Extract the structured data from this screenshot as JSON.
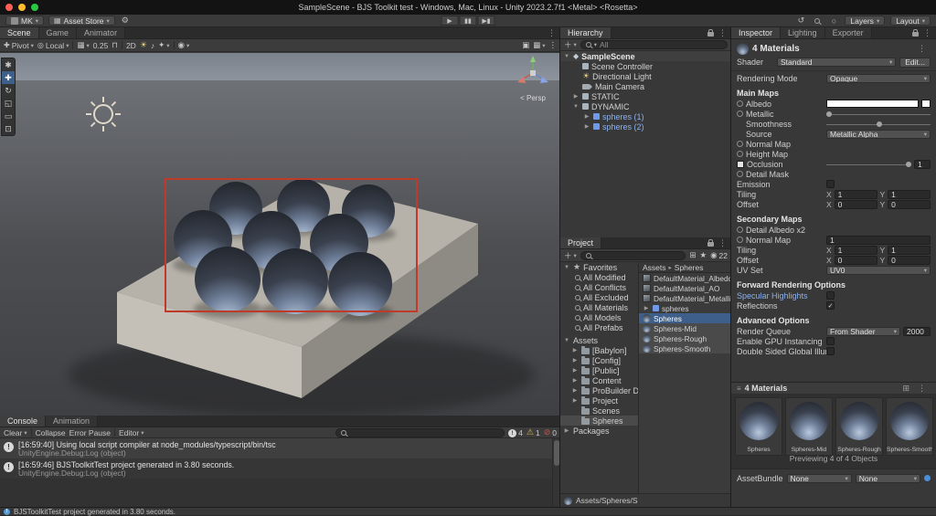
{
  "menubar": {
    "title": "SampleScene - BJS Toolkit test - Windows, Mac, Linux - Unity 2023.2.7f1 <Metal> <Rosetta>"
  },
  "topbar": {
    "account": "MK",
    "asset_store": "Asset Store",
    "layers": "Layers",
    "layout": "Layout"
  },
  "scene": {
    "tabs": [
      "Scene",
      "Game",
      "Animator"
    ],
    "pivot": "Pivot",
    "local": "Local",
    "snap": "0.25",
    "two_d": "2D",
    "persp": "< Persp"
  },
  "console": {
    "tabs": [
      "Console",
      "Animation"
    ],
    "clear": "Clear",
    "collapse": "Collapse",
    "error_pause": "Error Pause",
    "editor": "Editor",
    "info_count": "4",
    "warn_count": "1",
    "error_count": "0",
    "entries": [
      {
        "line1": "[16:59:40] Using local script compiler at node_modules/typescript/bin/tsc",
        "line2": "UnityEngine.Debug:Log (object)"
      },
      {
        "line1": "[16:59:46] BJSToolkitTest project generated in 3.80 seconds.",
        "line2": "UnityEngine.Debug:Log (object)"
      }
    ]
  },
  "hierarchy": {
    "tab": "Hierarchy",
    "search": "All",
    "items": [
      {
        "label": "SampleScene"
      },
      {
        "label": "Scene Controller"
      },
      {
        "label": "Directional Light"
      },
      {
        "label": "Main Camera"
      },
      {
        "label": "STATIC"
      },
      {
        "label": "DYNAMIC"
      },
      {
        "label": "spheres (1)"
      },
      {
        "label": "spheres (2)"
      }
    ]
  },
  "project": {
    "tab": "Project",
    "hidden_count": "22",
    "favorites_label": "Favorites",
    "favorites": [
      "All Modified",
      "All Conflicts",
      "All Excluded",
      "All Materials",
      "All Models",
      "All Prefabs"
    ],
    "assets_label": "Assets",
    "folders": [
      "[Babylon]",
      "[Config]",
      "[Public]",
      "Content",
      "ProBuilder Data",
      "Project",
      "Scenes",
      "Spheres"
    ],
    "packages_label": "Packages",
    "breadcrumb_root": "Assets",
    "breadcrumb_current": "Spheres",
    "files": [
      "DefaultMaterial_Albedo",
      "DefaultMaterial_AO",
      "DefaultMaterial_Metallic",
      "spheres",
      "Spheres",
      "Spheres-Mid",
      "Spheres-Rough",
      "Spheres-Smooth"
    ],
    "footer_path": "Assets/Spheres/S"
  },
  "inspector": {
    "tabs": [
      "Inspector",
      "Lighting",
      "Exporter"
    ],
    "title": "4 Materials",
    "shader_label": "Shader",
    "shader_value": "Standard",
    "edit_button": "Edit...",
    "rendering_mode_label": "Rendering Mode",
    "rendering_mode_value": "Opaque",
    "main_maps": "Main Maps",
    "albedo": "Albedo",
    "metallic": "Metallic",
    "smoothness": "Smoothness",
    "source_label": "Source",
    "source_value": "Metallic Alpha",
    "normal_map": "Normal Map",
    "height_map": "Height Map",
    "occlusion": "Occlusion",
    "occlusion_value": "1",
    "detail_mask": "Detail Mask",
    "emission": "Emission",
    "tiling": "Tiling",
    "offset": "Offset",
    "x": "X",
    "y": "Y",
    "tiling_x": "1",
    "tiling_y": "1",
    "offset_x": "0",
    "offset_y": "0",
    "secondary_maps": "Secondary Maps",
    "detail_albedo": "Detail Albedo x2",
    "normal_map2": "Normal Map",
    "normal_map2_value": "1",
    "tiling2_x": "1",
    "tiling2_y": "1",
    "offset2_x": "0",
    "offset2_y": "0",
    "uv_set_label": "UV Set",
    "uv_set_value": "UV0",
    "forward_header": "Forward Rendering Options",
    "specular": "Specular Highlights",
    "reflections": "Reflections",
    "advanced_header": "Advanced Options",
    "render_queue_label": "Render Queue",
    "render_queue_value": "From Shader",
    "render_queue_number": "2000",
    "gpu_instancing": "Enable GPU Instancing",
    "double_sided": "Double Sided Global Illum",
    "preview_header": "4 Materials",
    "previews": [
      "Spheres",
      "Spheres-Mid",
      "Spheres-Rough",
      "Spheres-Smooth"
    ],
    "preview_status": "Previewing 4 of 4 Objects",
    "assetbundle_label": "AssetBundle",
    "bundle_none1": "None",
    "bundle_none2": "None"
  },
  "statusbar": {
    "message": "BJSToolkitTest project generated in 3.80 seconds."
  },
  "colors": {
    "prefab_blue": "#7fa6e0",
    "selection_blue": "#3e5f8a",
    "selection_red": "#bf3a28",
    "warning_yellow": "#d6b44c"
  }
}
